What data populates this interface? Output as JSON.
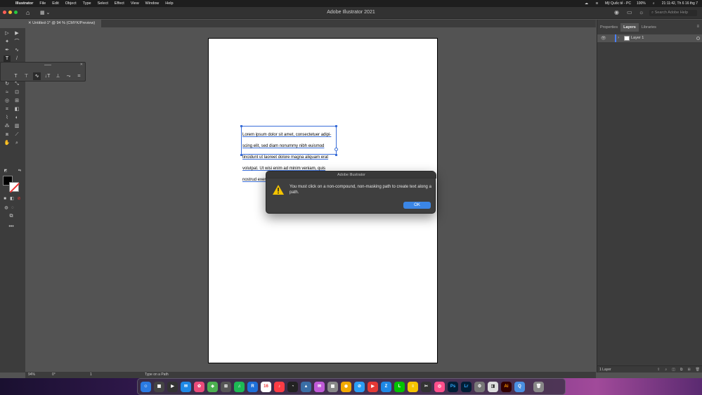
{
  "menubar": {
    "app_name": "Illustrator",
    "menus": [
      "File",
      "Edit",
      "Object",
      "Type",
      "Select",
      "Effect",
      "View",
      "Window",
      "Help"
    ],
    "user": "Mỹ Quốc tế - PC",
    "battery": "100%",
    "clock": "21:11:42, Th 6 16 thg 7"
  },
  "appbar": {
    "title": "Adobe Illustrator 2021",
    "search_placeholder": "Search Adobe Help"
  },
  "document": {
    "tab_label": "Untitled-1* @ 94 % (CMYK/Preview)"
  },
  "textbox": {
    "lines": [
      "Lorem ipsum dolor sit amet, consectetuer adipi-",
      "scing elit, sed diam nonummy nibh euismod",
      "tincidunt ut laoreet dolore magna aliquam erat",
      "volutpat. Ut wisi enim ad minim veniam, quis",
      "nostrud exerci tation ullamcorper suscipit lobor"
    ]
  },
  "dialog": {
    "title": "Adobe Illustrator",
    "message": "You must click on a non-compound, non-masking path to create text along a path.",
    "ok_label": "OK",
    "icon": "warning-icon"
  },
  "panel": {
    "tabs": [
      "Properties",
      "Layers",
      "Libraries"
    ],
    "active_tab": "Layers",
    "layer_name": "Layer 1",
    "layer_count": "1 Layer",
    "layer_color": "#4a7fff"
  },
  "statusbar": {
    "zoom": "94%",
    "rotation": "0°",
    "artboard": "1",
    "tool": "Type on a Path"
  },
  "colors": {
    "accent": "#3b86e6",
    "selection": "#3a6ed8"
  }
}
